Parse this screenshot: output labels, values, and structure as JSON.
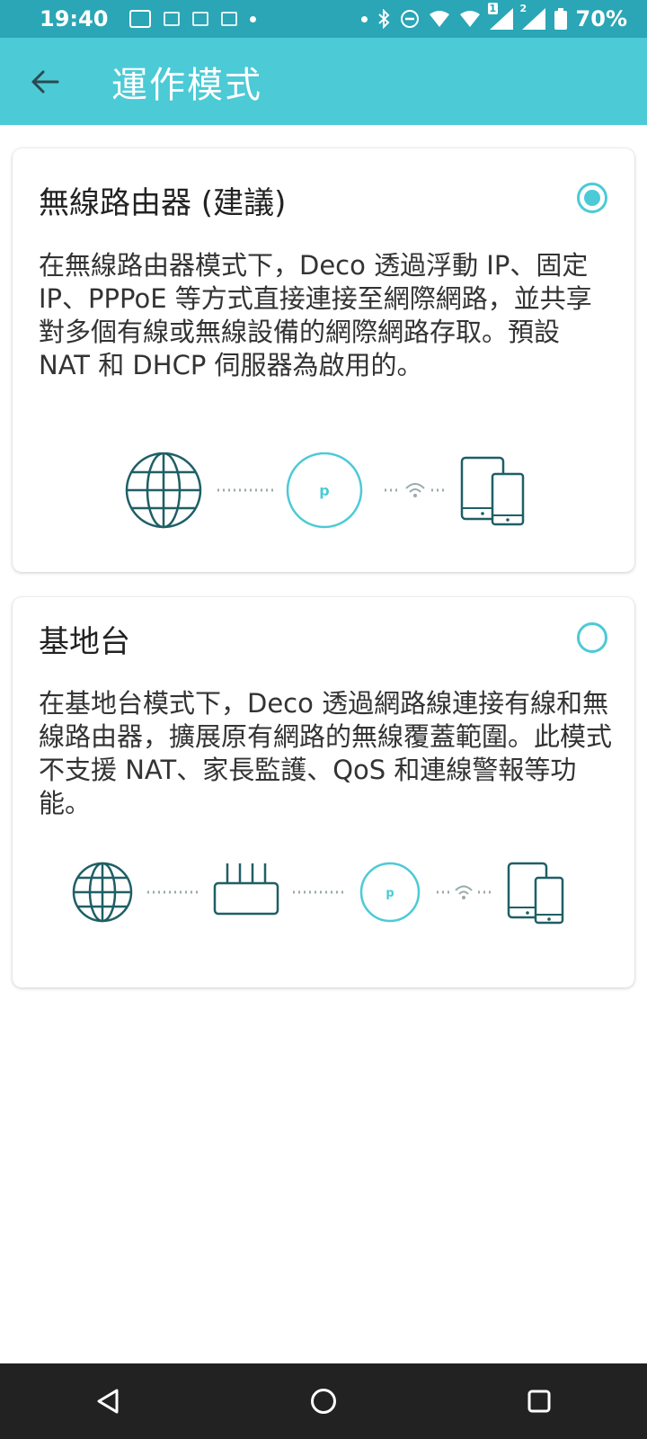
{
  "status_bar": {
    "time": "19:40",
    "battery": "70%",
    "icons": [
      "notification-box-icon",
      "app-icon",
      "app-icon",
      "app-icon",
      "dot-icon",
      "dot-icon",
      "bluetooth-icon",
      "dnd-icon",
      "wifi-icon",
      "wifi-icon",
      "signal-icon",
      "signal-icon",
      "battery-icon"
    ],
    "signal_labels": [
      "1",
      "2"
    ]
  },
  "app_bar": {
    "title": "運作模式",
    "back_icon": "arrow-left-icon",
    "background": "#4ccad6"
  },
  "modes": [
    {
      "title": "無線路由器 (建議)",
      "description": "在無線路由器模式下，Deco 透過浮動 IP、固定 IP、PPPoE 等方式直接連接至網際網路，並共享對多個有線或無線設備的網際網路存取。預設 NAT 和 DHCP 伺服器為啟用的。",
      "selected": true,
      "diagram": [
        "globe-icon",
        "deco-icon",
        "wifi-icon",
        "devices-icon"
      ],
      "deco_logo": "p"
    },
    {
      "title": "基地台",
      "description": "在基地台模式下，Deco 透過網路線連接有線和無線路由器，擴展原有網路的無線覆蓋範圍。此模式不支援 NAT、家長監護、QoS 和連線警報等功能。",
      "selected": false,
      "diagram": [
        "globe-icon",
        "router-icon",
        "deco-icon",
        "wifi-icon",
        "devices-icon"
      ],
      "deco_logo": "p"
    }
  ],
  "nav_bar": {
    "buttons": [
      "back-triangle-icon",
      "home-circle-icon",
      "recents-square-icon"
    ]
  },
  "colors": {
    "accent": "#4ccad6",
    "status_bar": "#2aa6b6",
    "icon_dark": "#1f5f66"
  }
}
